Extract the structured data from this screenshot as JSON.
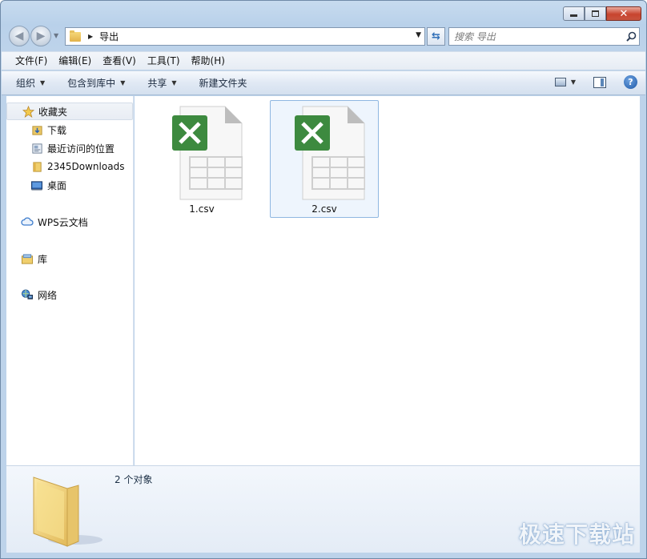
{
  "window": {
    "title": "导出"
  },
  "address": {
    "path": "导出"
  },
  "search": {
    "placeholder": "搜索 导出"
  },
  "menu": [
    "文件(F)",
    "编辑(E)",
    "查看(V)",
    "工具(T)",
    "帮助(H)"
  ],
  "toolbar": {
    "organize": "组织",
    "include_in_library": "包含到库中",
    "share": "共享",
    "new_folder": "新建文件夹"
  },
  "sidebar": {
    "favorites": "收藏夹",
    "items": [
      "下载",
      "最近访问的位置",
      "2345Downloads",
      "桌面"
    ],
    "wps": "WPS云文档",
    "library": "库",
    "network": "网络"
  },
  "files": [
    {
      "name": "1.csv",
      "selected": false
    },
    {
      "name": "2.csv",
      "selected": true
    }
  ],
  "status": {
    "count_text": "2 个对象"
  },
  "watermark": "极速下载站",
  "colors": {
    "excel_green": "#3d8a3f",
    "selection_border": "#8fb7e1",
    "accent": "#1c58a8"
  }
}
